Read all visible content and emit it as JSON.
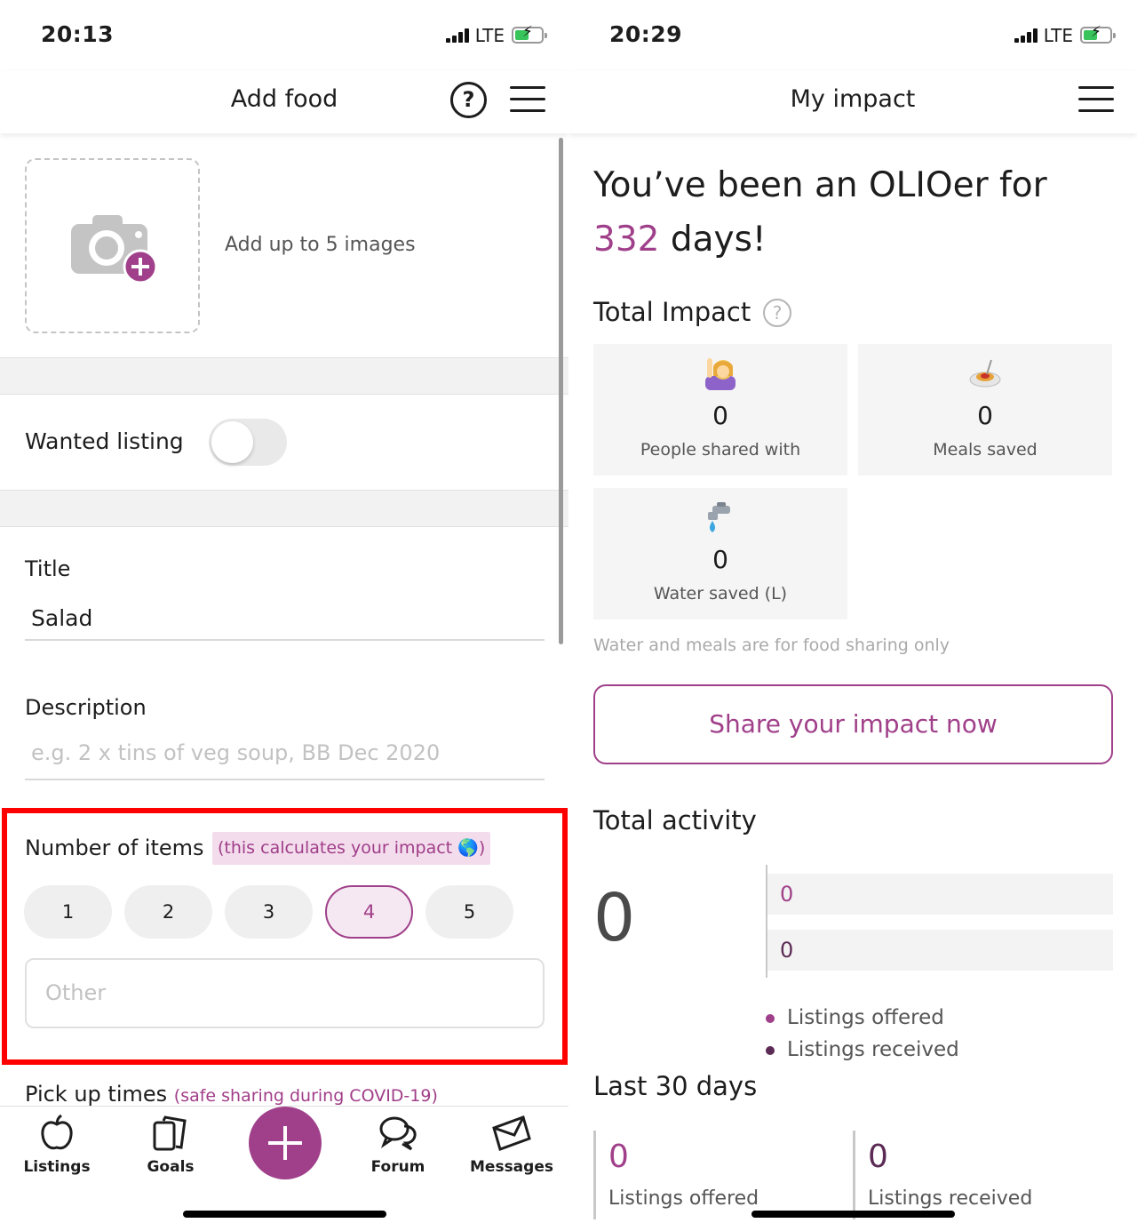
{
  "left_screen": {
    "status": {
      "time": "20:13",
      "network": "LTE"
    },
    "header": {
      "title": "Add food"
    },
    "images": {
      "hint": "Add up to 5 images"
    },
    "wanted_listing": {
      "label": "Wanted listing",
      "enabled": false
    },
    "title_field": {
      "label": "Title",
      "value": "Salad"
    },
    "description_field": {
      "label": "Description",
      "placeholder": "e.g. 2 x tins of veg soup, BB Dec 2020"
    },
    "number_of_items": {
      "label": "Number of items",
      "impact_note": "(this calculates your impact 🌎)",
      "options": [
        "1",
        "2",
        "3",
        "4",
        "5"
      ],
      "selected": "4",
      "other_placeholder": "Other"
    },
    "pickup": {
      "label": "Pick up times",
      "note": "(safe sharing during COVID-19)"
    },
    "tabbar": {
      "listings": "Listings",
      "goals": "Goals",
      "forum": "Forum",
      "messages": "Messages"
    }
  },
  "right_screen": {
    "status": {
      "time": "20:29",
      "network": "LTE"
    },
    "header": {
      "title": "My impact"
    },
    "headline": {
      "prefix": "You’ve been an OLIOer for ",
      "days": "332",
      "suffix": " days!"
    },
    "total_impact": {
      "title": "Total Impact",
      "cards": [
        {
          "icon": "person-raising-hand-icon",
          "value": "0",
          "label": "People shared with"
        },
        {
          "icon": "spaghetti-plate-icon",
          "value": "0",
          "label": "Meals saved"
        },
        {
          "icon": "water-tap-icon",
          "value": "0",
          "label": "Water saved (L)"
        }
      ],
      "note": "Water and meals are for food sharing only"
    },
    "share_button": "Share your impact now",
    "total_activity": {
      "title": "Total activity",
      "total": "0",
      "offered": "0",
      "received": "0",
      "legend_offered": "Listings offered",
      "legend_received": "Listings received"
    },
    "last_30_days": {
      "title": "Last 30 days",
      "offered_value": "0",
      "offered_label": "Listings offered",
      "received_value": "0",
      "received_label": "Listings received"
    }
  },
  "colors": {
    "brand": "#a0408a",
    "brand_dark": "#5b2a55",
    "highlight_box": "#ff0000",
    "card_bg": "#f5f5f5"
  }
}
